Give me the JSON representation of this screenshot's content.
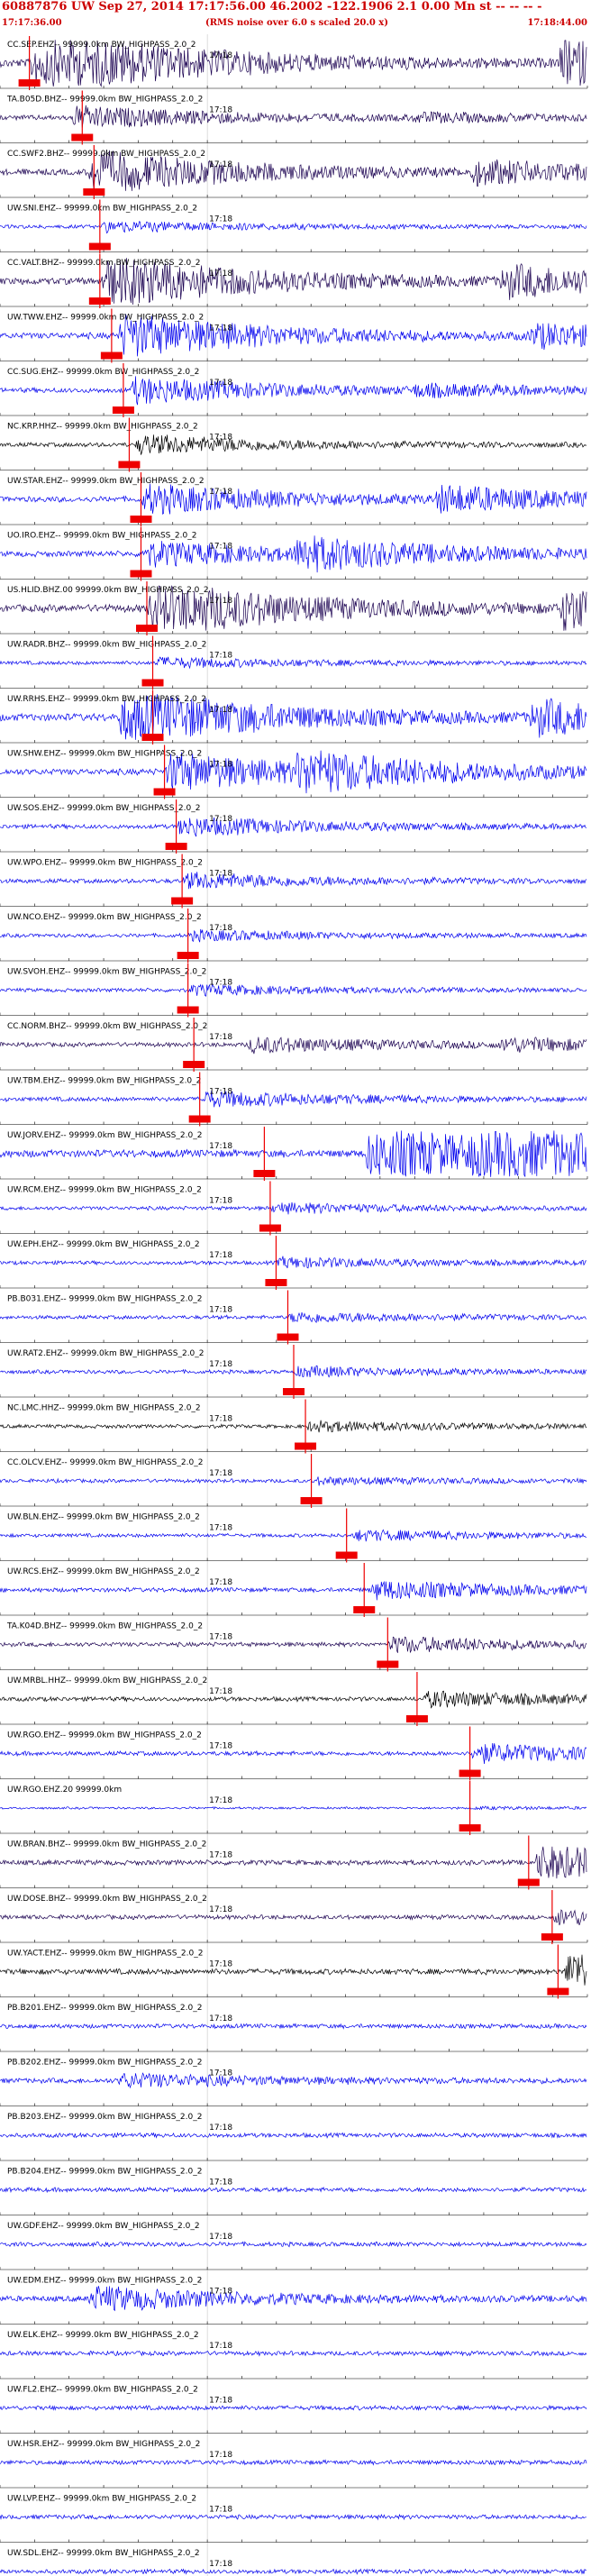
{
  "header": {
    "title": "60887876 UW Sep 27, 2014 17:17:56.00    46.2002 -122.1906  2.1 0.00 Mn st -- -- -- -",
    "start_time": "17:17:36.00",
    "end_time": "17:18:44.00",
    "rms_note": "(RMS noise over 6.0 s scaled 20.0 x)"
  },
  "colors": {
    "blue": "#0000ee",
    "navy": "#1a0050",
    "black": "#000000",
    "red": "#ee0000",
    "grid": "#888888"
  },
  "chart_data": {
    "type": "line",
    "x_start": "17:17:36.00",
    "x_end": "17:18:44.00",
    "tick_label": "17:18",
    "traces": [
      {
        "label": "CC.SEP.EHZ-- 99999.0km BW_HIGHPASS_2.0_2",
        "color": "navy",
        "pick": 0.05,
        "energy": [
          [
            0.05,
            1.0
          ],
          [
            0.95,
            0.9
          ]
        ],
        "amp": 1.0
      },
      {
        "label": "TA.B05D.BHZ-- 99999.0km BW_HIGHPASS_2.0_2",
        "color": "navy",
        "pick": 0.14,
        "energy": [
          [
            0.12,
            0.5
          ],
          [
            0.7,
            0.15
          ]
        ],
        "amp": 0.5
      },
      {
        "label": "CC.SWF2.BHZ-- 99999.0km BW_HIGHPASS_2.0_2",
        "color": "navy",
        "pick": 0.16,
        "energy": [
          [
            0.15,
            0.8
          ],
          [
            0.8,
            0.4
          ]
        ],
        "amp": 0.7
      },
      {
        "label": "UW.SNI.EHZ-- 99999.0km BW_HIGHPASS_2.0_2",
        "color": "blue",
        "pick": 0.17,
        "energy": [
          [
            0.17,
            0.3
          ]
        ],
        "amp": 0.3
      },
      {
        "label": "CC.VALT.BHZ-- 99999.0km BW_HIGHPASS_2.0_2",
        "color": "navy",
        "pick": 0.17,
        "energy": [
          [
            0.17,
            0.9
          ],
          [
            0.85,
            0.5
          ]
        ],
        "amp": 0.8
      },
      {
        "label": "UW.TWW.EHZ-- 99999.0km BW_HIGHPASS_2.0_2",
        "color": "blue",
        "pick": 0.19,
        "energy": [
          [
            0.2,
            0.8
          ],
          [
            0.9,
            0.4
          ]
        ],
        "amp": 0.7
      },
      {
        "label": "CC.SUG.EHZ-- 99999.0km BW_HIGHPASS_2.0_2",
        "color": "blue",
        "pick": 0.21,
        "energy": [
          [
            0.22,
            0.6
          ],
          [
            0.7,
            0.2
          ]
        ],
        "amp": 0.5
      },
      {
        "label": "NC.KRP.HHZ-- 99999.0km BW_HIGHPASS_2.0_2",
        "color": "black",
        "pick": 0.22,
        "energy": [
          [
            0.23,
            0.5
          ]
        ],
        "amp": 0.4
      },
      {
        "label": "UW.STAR.EHZ-- 99999.0km BW_HIGHPASS_2.0_2",
        "color": "blue",
        "pick": 0.24,
        "energy": [
          [
            0.24,
            0.6
          ],
          [
            0.74,
            0.5
          ]
        ],
        "amp": 0.6
      },
      {
        "label": "UO.IRO.EHZ-- 99999.0km BW_HIGHPASS_2.0_2",
        "color": "blue",
        "pick": 0.24,
        "energy": [
          [
            0.24,
            0.5
          ],
          [
            0.5,
            0.6
          ]
        ],
        "amp": 0.6
      },
      {
        "label": "US.HLID.BHZ.00 99999.0km BW_HIGHPASS_2.0_2",
        "color": "navy",
        "pick": 0.25,
        "energy": [
          [
            0.25,
            0.9
          ],
          [
            0.95,
            0.6
          ]
        ],
        "amp": 0.9
      },
      {
        "label": "UW.RADR.BHZ-- 99999.0km BW_HIGHPASS_2.0_2",
        "color": "blue",
        "pick": 0.26,
        "energy": [
          [
            0.26,
            0.3
          ]
        ],
        "amp": 0.3
      },
      {
        "label": "UW.RRHS.EHZ-- 99999.0km BW_HIGHPASS_2.0_2",
        "color": "blue",
        "pick": 0.26,
        "energy": [
          [
            0.2,
            0.9
          ],
          [
            0.9,
            0.5
          ]
        ],
        "amp": 0.9
      },
      {
        "label": "UW.SHW.EHZ-- 99999.0km BW_HIGHPASS_2.0_2",
        "color": "blue",
        "pick": 0.28,
        "energy": [
          [
            0.28,
            0.7
          ],
          [
            0.5,
            0.6
          ]
        ],
        "amp": 0.7
      },
      {
        "label": "UW.SOS.EHZ-- 99999.0km BW_HIGHPASS_2.0_2",
        "color": "blue",
        "pick": 0.3,
        "energy": [
          [
            0.3,
            0.5
          ]
        ],
        "amp": 0.4
      },
      {
        "label": "UW.WPO.EHZ-- 99999.0km BW_HIGHPASS_2.0_2",
        "color": "blue",
        "pick": 0.31,
        "energy": [
          [
            0.31,
            0.4
          ]
        ],
        "amp": 0.4
      },
      {
        "label": "UW.NCO.EHZ-- 99999.0km BW_HIGHPASS_2.0_2",
        "color": "blue",
        "pick": 0.32,
        "energy": [
          [
            0.32,
            0.3
          ]
        ],
        "amp": 0.3
      },
      {
        "label": "UW.SVOH.EHZ-- 99999.0km BW_HIGHPASS_2.0_2",
        "color": "blue",
        "pick": 0.32,
        "energy": [
          [
            0.32,
            0.3
          ]
        ],
        "amp": 0.3
      },
      {
        "label": "CC.NORM.BHZ-- 99999.0km BW_HIGHPASS_2.0_2",
        "color": "navy",
        "pick": 0.33,
        "energy": [
          [
            0.42,
            0.4
          ],
          [
            0.85,
            0.3
          ]
        ],
        "amp": 0.4
      },
      {
        "label": "UW.TBM.EHZ-- 99999.0km BW_HIGHPASS_2.0_2",
        "color": "blue",
        "pick": 0.34,
        "energy": [
          [
            0.34,
            0.4
          ]
        ],
        "amp": 0.4
      },
      {
        "label": "UW.JORV.EHZ-- 99999.0km BW_HIGHPASS_2.0_2",
        "color": "blue",
        "pick": 0.45,
        "energy": [
          [
            0.62,
            0.9
          ],
          [
            0.8,
            0.7
          ]
        ],
        "amp": 0.9
      },
      {
        "label": "UW.RCM.EHZ-- 99999.0km BW_HIGHPASS_2.0_2",
        "color": "blue",
        "pick": 0.46,
        "energy": [
          [
            0.46,
            0.3
          ]
        ],
        "amp": 0.3
      },
      {
        "label": "UW.EPH.EHZ-- 99999.0km BW_HIGHPASS_2.0_2",
        "color": "blue",
        "pick": 0.47,
        "energy": [
          [
            0.47,
            0.3
          ]
        ],
        "amp": 0.3
      },
      {
        "label": "PB.B031.EHZ-- 99999.0km BW_HIGHPASS_2.0_2",
        "color": "blue",
        "pick": 0.49,
        "energy": [
          [
            0.49,
            0.3
          ]
        ],
        "amp": 0.3
      },
      {
        "label": "UW.RAT2.EHZ-- 99999.0km BW_HIGHPASS_2.0_2",
        "color": "blue",
        "pick": 0.5,
        "energy": [
          [
            0.5,
            0.3
          ]
        ],
        "amp": 0.3
      },
      {
        "label": "NC.LMC.HHZ-- 99999.0km BW_HIGHPASS_2.0_2",
        "color": "black",
        "pick": 0.52,
        "energy": [
          [
            0.52,
            0.3
          ]
        ],
        "amp": 0.3
      },
      {
        "label": "CC.OLCV.EHZ-- 99999.0km BW_HIGHPASS_2.0_2",
        "color": "blue",
        "pick": 0.53,
        "energy": [
          [
            0.53,
            0.2
          ]
        ],
        "amp": 0.3
      },
      {
        "label": "UW.BLN.EHZ-- 99999.0km BW_HIGHPASS_2.0_2",
        "color": "blue",
        "pick": 0.59,
        "energy": [
          [
            0.6,
            0.3
          ]
        ],
        "amp": 0.3
      },
      {
        "label": "UW.RCS.EHZ-- 99999.0km BW_HIGHPASS_2.0_2",
        "color": "blue",
        "pick": 0.62,
        "energy": [
          [
            0.63,
            0.5
          ]
        ],
        "amp": 0.4
      },
      {
        "label": "TA.K04D.BHZ-- 99999.0km BW_HIGHPASS_2.0_2",
        "color": "navy",
        "pick": 0.66,
        "energy": [
          [
            0.66,
            0.4
          ]
        ],
        "amp": 0.4
      },
      {
        "label": "UW.MRBL.HHZ-- 99999.0km BW_HIGHPASS_2.0_2",
        "color": "black",
        "pick": 0.71,
        "energy": [
          [
            0.72,
            0.4
          ]
        ],
        "amp": 0.4
      },
      {
        "label": "UW.RGO.EHZ-- 99999.0km BW_HIGHPASS_2.0_2",
        "color": "blue",
        "pick": 0.8,
        "energy": [
          [
            0.8,
            0.5
          ]
        ],
        "amp": 0.4
      },
      {
        "label": "UW.RGO.EHZ.20 99999.0km",
        "color": "blue",
        "pick": 0.8,
        "energy": [
          [
            0.8,
            0.1
          ]
        ],
        "amp": 0.05
      },
      {
        "label": "UW.BRAN.BHZ-- 99999.0km BW_HIGHPASS_2.0_2",
        "color": "navy",
        "pick": 0.9,
        "energy": [
          [
            0.91,
            0.8
          ]
        ],
        "amp": 0.5
      },
      {
        "label": "UW.DOSE.BHZ-- 99999.0km BW_HIGHPASS_2.0_2",
        "color": "navy",
        "pick": 0.94,
        "energy": [
          [
            0.94,
            0.4
          ]
        ],
        "amp": 0.4
      },
      {
        "label": "UW.YACT.EHZ-- 99999.0km BW_HIGHPASS_2.0_2",
        "color": "black",
        "pick": 0.95,
        "energy": [
          [
            0.96,
            0.8
          ]
        ],
        "amp": 0.6
      },
      {
        "label": "PB.B201.EHZ-- 99999.0km BW_HIGHPASS_2.0_2",
        "color": "blue",
        "pick": null,
        "energy": [],
        "amp": 0.4
      },
      {
        "label": "PB.B202.EHZ-- 99999.0km BW_HIGHPASS_2.0_2",
        "color": "blue",
        "pick": null,
        "energy": [
          [
            0.2,
            0.3
          ]
        ],
        "amp": 0.5
      },
      {
        "label": "PB.B203.EHZ-- 99999.0km BW_HIGHPASS_2.0_2",
        "color": "blue",
        "pick": null,
        "energy": [],
        "amp": 0.4
      },
      {
        "label": "PB.B204.EHZ-- 99999.0km BW_HIGHPASS_2.0_2",
        "color": "blue",
        "pick": null,
        "energy": [],
        "amp": 0.4
      },
      {
        "label": "UW.GDF.EHZ-- 99999.0km BW_HIGHPASS_2.0_2",
        "color": "blue",
        "pick": null,
        "energy": [],
        "amp": 0.4
      },
      {
        "label": "UW.EDM.EHZ-- 99999.0km BW_HIGHPASS_2.0_2",
        "color": "blue",
        "pick": null,
        "energy": [
          [
            0.15,
            0.5
          ]
        ],
        "amp": 0.6
      },
      {
        "label": "UW.ELK.EHZ-- 99999.0km BW_HIGHPASS_2.0_2",
        "color": "blue",
        "pick": null,
        "energy": [],
        "amp": 0.4
      },
      {
        "label": "UW.FL2.EHZ-- 99999.0km BW_HIGHPASS_2.0_2",
        "color": "blue",
        "pick": null,
        "energy": [],
        "amp": 0.4
      },
      {
        "label": "UW.HSR.EHZ-- 99999.0km BW_HIGHPASS_2.0_2",
        "color": "blue",
        "pick": null,
        "energy": [],
        "amp": 0.4
      },
      {
        "label": "UW.LVP.EHZ-- 99999.0km BW_HIGHPASS_2.0_2",
        "color": "blue",
        "pick": null,
        "energy": [],
        "amp": 0.4
      },
      {
        "label": "UW.SDL.EHZ-- 99999.0km BW_HIGHPASS_2.0_2",
        "color": "blue",
        "pick": null,
        "energy": [],
        "amp": 0.4
      }
    ]
  }
}
